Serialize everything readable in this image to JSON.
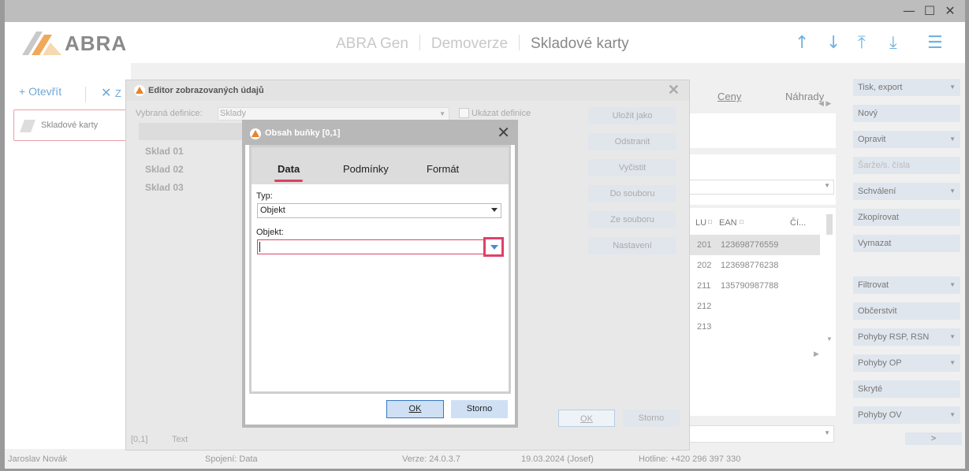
{
  "window": {
    "controls": [
      "—",
      "☐",
      "✕"
    ]
  },
  "header": {
    "logo_text": "ABRA",
    "breadcrumb": [
      "ABRA Gen",
      "Demoverze",
      "Skladové karty"
    ],
    "nav_icons": [
      "arrow-up-icon",
      "arrow-down-icon",
      "arrow-top-icon",
      "arrow-bottom-icon",
      "menu-icon"
    ]
  },
  "toolbar": {
    "open_label": "Otevřít",
    "close_label": "Z"
  },
  "left_tab": {
    "label": "Skladové karty"
  },
  "middle": {
    "tabs": [
      "Ceny",
      "Náhrady"
    ],
    "columns": [
      "LU",
      "EAN",
      "Čí..."
    ],
    "rows": [
      {
        "code": "201",
        "ean": "123698776559"
      },
      {
        "code": "202",
        "ean": "123698776238"
      },
      {
        "code": "211",
        "ean": "135790987788"
      },
      {
        "code": "212",
        "ean": ""
      },
      {
        "code": "213",
        "ean": ""
      }
    ]
  },
  "right_panel": {
    "buttons": [
      {
        "label": "Tisk, export",
        "dropdown": true
      },
      {
        "label": "Nový",
        "dropdown": false
      },
      {
        "label": "Opravit",
        "dropdown": true
      },
      {
        "label": "Šarže/s. čísla",
        "dropdown": false,
        "disabled": true
      },
      {
        "label": "Schválení",
        "dropdown": true
      },
      {
        "label": "Zkopírovat",
        "dropdown": false
      },
      {
        "label": "Vymazat",
        "dropdown": false
      },
      {
        "label": "Filtrovat",
        "dropdown": true
      },
      {
        "label": "Občerstvit",
        "dropdown": false
      },
      {
        "label": "Pohyby RSP, RSN",
        "dropdown": true
      },
      {
        "label": "Pohyby OP",
        "dropdown": true
      },
      {
        "label": "Skryté",
        "dropdown": false
      },
      {
        "label": "Pohyby OV",
        "dropdown": true
      }
    ],
    "more": ">"
  },
  "status": {
    "user": "Jaroslav Novák",
    "connection": "Spojení: Data",
    "version": "Verze: 24.0.3.7",
    "date": "19.03.2024 (Josef)",
    "hotline": "Hotline: +420 296 397 330"
  },
  "editor": {
    "title": "Editor zobrazovaných údajů",
    "definition_label": "Vybraná definice:",
    "definition_value": "Sklady",
    "show_definition_label": "Ukázat definice",
    "buttons": [
      "Uložit jako",
      "Odstranit",
      "Vyčistit",
      "Do souboru",
      "Ze souboru",
      "Nastavení"
    ],
    "rows": [
      "Sklad 01",
      "Sklad 02",
      "Sklad 03"
    ],
    "cell_ref": "[0,1]",
    "cell_text": "Text",
    "ok_label": "OK",
    "cancel_label": "Storno"
  },
  "cell_dialog": {
    "title": "Obsah buňky [0,1]",
    "tabs": [
      "Data",
      "Podmínky",
      "Formát"
    ],
    "active_tab": "Data",
    "type_label": "Typ:",
    "type_value": "Objekt",
    "object_label": "Objekt:",
    "object_value": "",
    "ok_label": "OK",
    "cancel_label": "Storno"
  }
}
